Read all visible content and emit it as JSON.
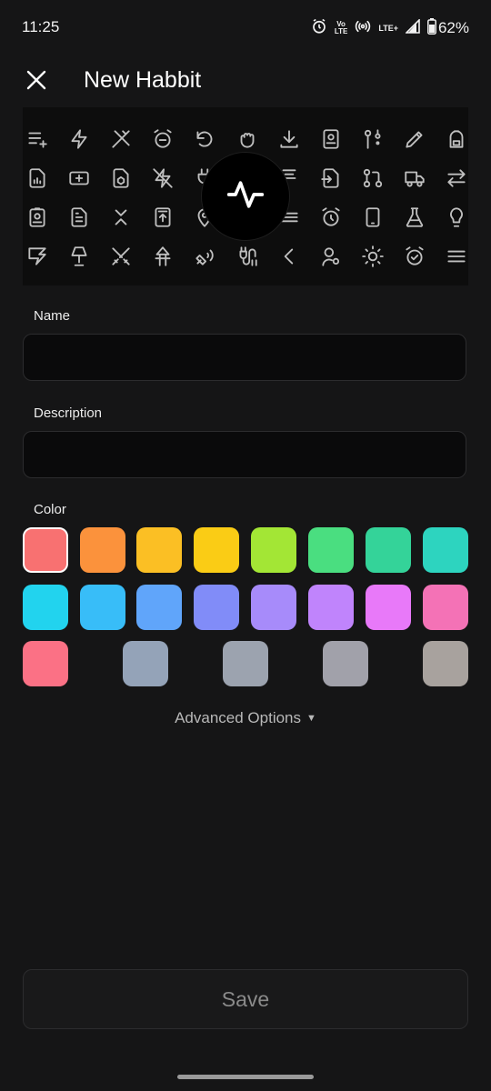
{
  "status_bar": {
    "time": "11:25",
    "volte_top": "Vo",
    "volte_bottom": "LTE",
    "lte_label": "LTE+",
    "battery": "62%",
    "icons": [
      "alarm-icon",
      "volte-icon",
      "hotspot-icon",
      "signal-icon",
      "battery-icon"
    ]
  },
  "app_bar": {
    "title": "New Habbit",
    "close_icon": "close-icon"
  },
  "icon_picker": {
    "selected_icon": "activity-pulse-icon",
    "icons": [
      "list-add-icon",
      "bolt-icon",
      "tools-crossed-icon",
      "alarm-minus-icon",
      "rotate-ccw-icon",
      "hand-icon",
      "download-icon",
      "id-book-icon",
      "switch-vertical-icon",
      "pencil-icon",
      "backpack-icon",
      "file-chart-icon",
      "ticket-icon",
      "package-file-icon",
      "bolt-off-icon",
      "plug-icon",
      "",
      "lamp-icon",
      "file-import-icon",
      "git-pull-request-icon",
      "truck-icon",
      "arrows-exchange-icon",
      "id-badge-icon",
      "file-text-icon",
      "chevrons-vertical-icon",
      "book-upload-icon",
      "map-pin-icon",
      "",
      "align-icon",
      "alarm-icon",
      "device-mobile-icon",
      "flask-icon",
      "bulb-icon",
      "brand-icon",
      "desk-lamp-icon",
      "swords-icon",
      "bench-icon",
      "satellite-icon",
      "cable-icon",
      "chevron-left-icon",
      "user-cog-icon",
      "sun-icon",
      "alarm-check-icon",
      "menu-icon"
    ]
  },
  "name_field": {
    "label": "Name",
    "value": "",
    "placeholder": ""
  },
  "description_field": {
    "label": "Description",
    "value": "",
    "placeholder": ""
  },
  "color_section": {
    "label": "Color",
    "selected": "#f87171",
    "colors": [
      "#f87171",
      "#fb923c",
      "#fbbf24",
      "#facc15",
      "#a3e635",
      "#4ade80",
      "#34d399",
      "#2dd4bf",
      "#22d3ee",
      "#38bdf8",
      "#60a5fa",
      "#818cf8",
      "#a78bfa",
      "#c084fc",
      "#e879f9",
      "#f472b6",
      "#fb7185",
      "#94a3b8",
      "#9ca3af",
      "#a1a1aa",
      "#a8a29e"
    ]
  },
  "advanced_options": {
    "label": "Advanced Options",
    "arrow": "▼"
  },
  "save_button": {
    "label": "Save"
  }
}
